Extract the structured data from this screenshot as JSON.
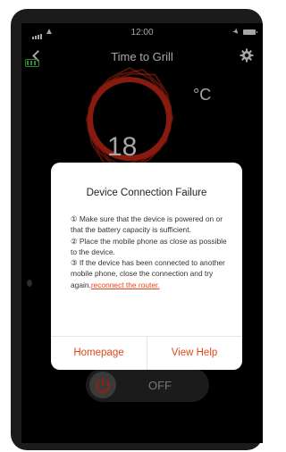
{
  "status_bar": {
    "time": "12:00"
  },
  "nav": {
    "title": "Time to Grill",
    "back_icon": "chevron-left-icon",
    "settings_icon": "gear-icon"
  },
  "device": {
    "battery_level": 1.0,
    "battery_color": "#45d24a"
  },
  "dial": {
    "unit": "°C",
    "value": "18",
    "ring_color": "#e8311c"
  },
  "power": {
    "state_label": "OFF"
  },
  "dialog": {
    "title": "Device Connection Failure",
    "item1": "① Make sure that the device is powered on or that the battery capacity is sufficient.",
    "item2": "② Place the mobile phone as close as possible to the device.",
    "item3_prefix": "③ If the device has been connected to another mobile phone, close the connection and try again.",
    "item3_link": "reconnect the router.",
    "homepage_label": "Homepage",
    "view_help_label": "View Help",
    "accent_color": "#e2471c"
  }
}
